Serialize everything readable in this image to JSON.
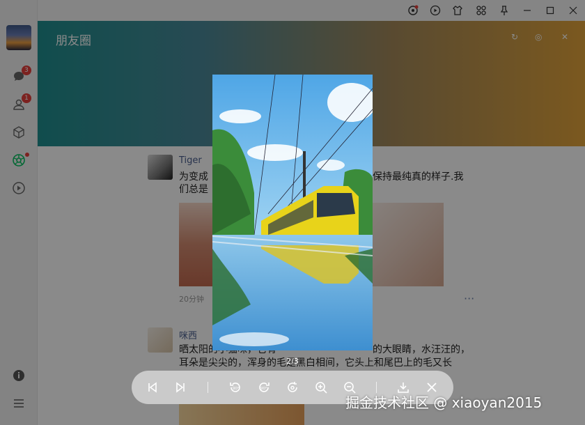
{
  "app": {
    "section_title": "朋友圈",
    "sidebar_badges": {
      "chat": "3",
      "contacts": "1"
    }
  },
  "posts": [
    {
      "author": "Tiger",
      "text_line1": "为变成",
      "text_line1_right": "保持最纯真的样子.我",
      "text_line2": "们总是",
      "time": "20分钟"
    },
    {
      "author": "咪西",
      "text_line1_left": "晒太阳的小猫咪，它有",
      "text_line1_right": "的大眼睛，水汪汪的，",
      "text_line2": "耳朵是尖尖的，浑身的毛是黑白相间，它头上和尾巴上的毛又长"
    }
  ],
  "viewer": {
    "counter": "2/3",
    "tools": [
      "first-icon",
      "last-icon",
      "rotate-left-icon",
      "rotate-right-icon",
      "reset-icon",
      "zoom-in-icon",
      "zoom-out-icon",
      "download-icon",
      "close-icon"
    ]
  },
  "watermark": "掘金技术社区 @ xiaoyan2015",
  "colors": {
    "accent_green": "#07c160",
    "badge_red": "#e5403c",
    "link_blue": "#4a5f8f"
  }
}
